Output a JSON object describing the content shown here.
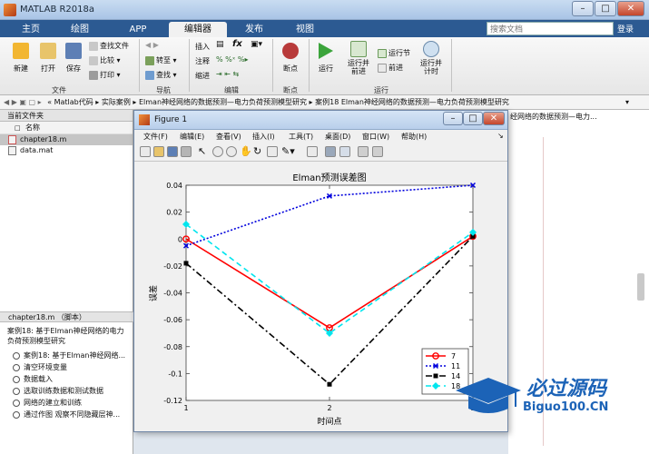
{
  "window": {
    "title": "MATLAB R2018a"
  },
  "ribbon_tabs": [
    "主页",
    "绘图",
    "APP",
    "编辑器",
    "发布",
    "视图"
  ],
  "search_placeholder": "搜索文档",
  "login": "登录",
  "ribbon": {
    "new": "新建",
    "open": "打开",
    "save": "保存",
    "find_files": "查找文件",
    "compare": "比较",
    "print": "打印",
    "goto": "转至",
    "find": "查找",
    "insert": "插入",
    "comment": "注释",
    "indent": "缩进",
    "fx": "fx",
    "breakpoint": "断点",
    "run": "运行",
    "run_advance": "运行并\n前进",
    "run_section": "运行节",
    "advance": "前进",
    "run_time": "运行并\n计时",
    "groups": [
      "文件",
      "导航",
      "编辑",
      "断点",
      "运行"
    ]
  },
  "address": {
    "parts": [
      "Matlab代码",
      "实际案例",
      "Elman神经网络的数据预测—电力负荷预测模型研究",
      "案例18 Elman神经网络的数据预测—电力负荷预测模型研究"
    ]
  },
  "current_folder": {
    "header": "当前文件夹",
    "column": "名称",
    "files": [
      "chapter18.m",
      "data.mat"
    ]
  },
  "details": {
    "header": "chapter18.m （脚本）",
    "description": "案例18: 基于Elman神经网络的电力负荷预测模型研究",
    "outline": [
      "案例18: 基于Elman神经网络...",
      "清空环境变量",
      "数据载入",
      "选取训练数据和测试数据",
      "网络的建立和训练",
      "通过作图 观察不同隐藏层神..."
    ]
  },
  "figure": {
    "title": "Figure 1",
    "menu": [
      "文件(F)",
      "编辑(E)",
      "查看(V)",
      "插入(I)",
      "工具(T)",
      "桌面(D)",
      "窗口(W)",
      "帮助(H)"
    ]
  },
  "behind_text": "经网络的数据预测—电力...",
  "watermark": {
    "cn": "必过源码",
    "en": "Biguo100.CN"
  },
  "chart_data": {
    "type": "line",
    "title": "Elman预测误差图",
    "xlabel": "时间点",
    "ylabel": "误差",
    "x": [
      1,
      2,
      3
    ],
    "xticks": [
      "1",
      "2",
      "3"
    ],
    "ylim": [
      -0.12,
      0.04
    ],
    "yticks": [
      "0.04",
      "0.02",
      "0",
      "-0.02",
      "-0.04",
      "-0.06",
      "-0.08",
      "-0.1",
      "-0.12"
    ],
    "grid": false,
    "legend_position": "bottom-right",
    "series": [
      {
        "name": "7",
        "values": [
          0.0,
          -0.066,
          0.002
        ],
        "color": "#ff0000",
        "dash": "",
        "marker": "circle"
      },
      {
        "name": "11",
        "values": [
          -0.005,
          0.032,
          0.04
        ],
        "color": "#0000dd",
        "dash": "2,2",
        "marker": "x"
      },
      {
        "name": "14",
        "values": [
          -0.018,
          -0.108,
          0.002
        ],
        "color": "#000000",
        "dash": "7,3,2,3",
        "marker": "square"
      },
      {
        "name": "18",
        "values": [
          0.011,
          -0.07,
          0.005
        ],
        "color": "#00e5ee",
        "dash": "6,4",
        "marker": "diamond"
      }
    ]
  }
}
